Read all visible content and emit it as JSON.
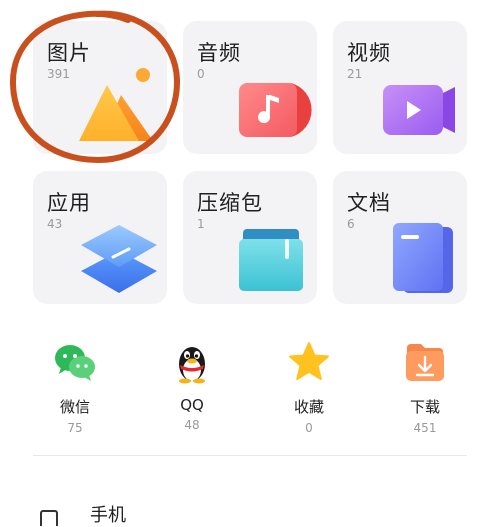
{
  "categories": [
    {
      "key": "images",
      "label": "图片",
      "count": "391"
    },
    {
      "key": "audio",
      "label": "音频",
      "count": "0"
    },
    {
      "key": "video",
      "label": "视频",
      "count": "21"
    },
    {
      "key": "apps",
      "label": "应用",
      "count": "43"
    },
    {
      "key": "archives",
      "label": "压缩包",
      "count": "1"
    },
    {
      "key": "documents",
      "label": "文档",
      "count": "6"
    }
  ],
  "shortcuts": [
    {
      "key": "wechat",
      "label": "微信",
      "count": "75"
    },
    {
      "key": "qq",
      "label": "QQ",
      "count": "48"
    },
    {
      "key": "favorites",
      "label": "收藏",
      "count": "0"
    },
    {
      "key": "download",
      "label": "下载",
      "count": "451"
    }
  ],
  "storage": {
    "phone_label": "手机"
  },
  "colors": {
    "annotation": "#c8501e",
    "card_bg": "#f3f3f5"
  }
}
